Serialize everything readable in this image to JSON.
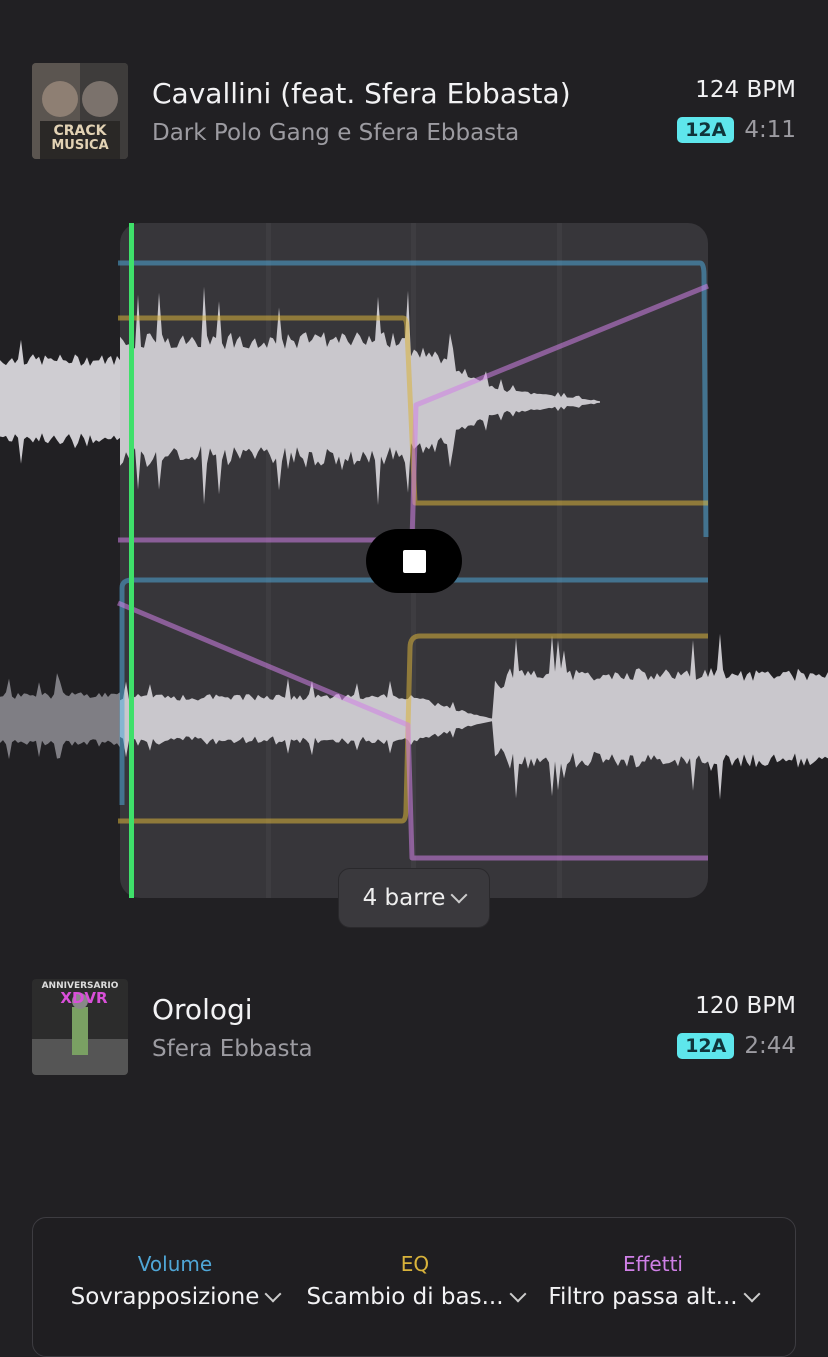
{
  "track_top": {
    "title": "Cavallini (feat. Sfera Ebbasta)",
    "artist": "Dark Polo Gang e Sfera Ebbasta",
    "bpm": "124 BPM",
    "key": "12A",
    "duration": "4:11",
    "art_text_1": "CRACK",
    "art_text_2": "MUSICA"
  },
  "track_bottom": {
    "title": "Orologi",
    "artist": "Sfera Ebbasta",
    "bpm": "120 BPM",
    "key": "12A",
    "duration": "2:44",
    "art_text_1": "ANNIVERSARIO",
    "art_text_2": "XDVR"
  },
  "transition": {
    "length_label": "4 barre"
  },
  "controls": {
    "volume": {
      "label": "Volume",
      "value": "Sovrapposizione"
    },
    "eq": {
      "label": "EQ",
      "value": "Scambio di bas..."
    },
    "effects": {
      "label": "Effetti",
      "value": "Filtro passa alt..."
    }
  },
  "colors": {
    "key_badge": "#5ee6ec",
    "volume": "#4fa6d6",
    "eq": "#d8b33b",
    "effects": "#cf7fe6",
    "playhead": "#3fe06a"
  }
}
